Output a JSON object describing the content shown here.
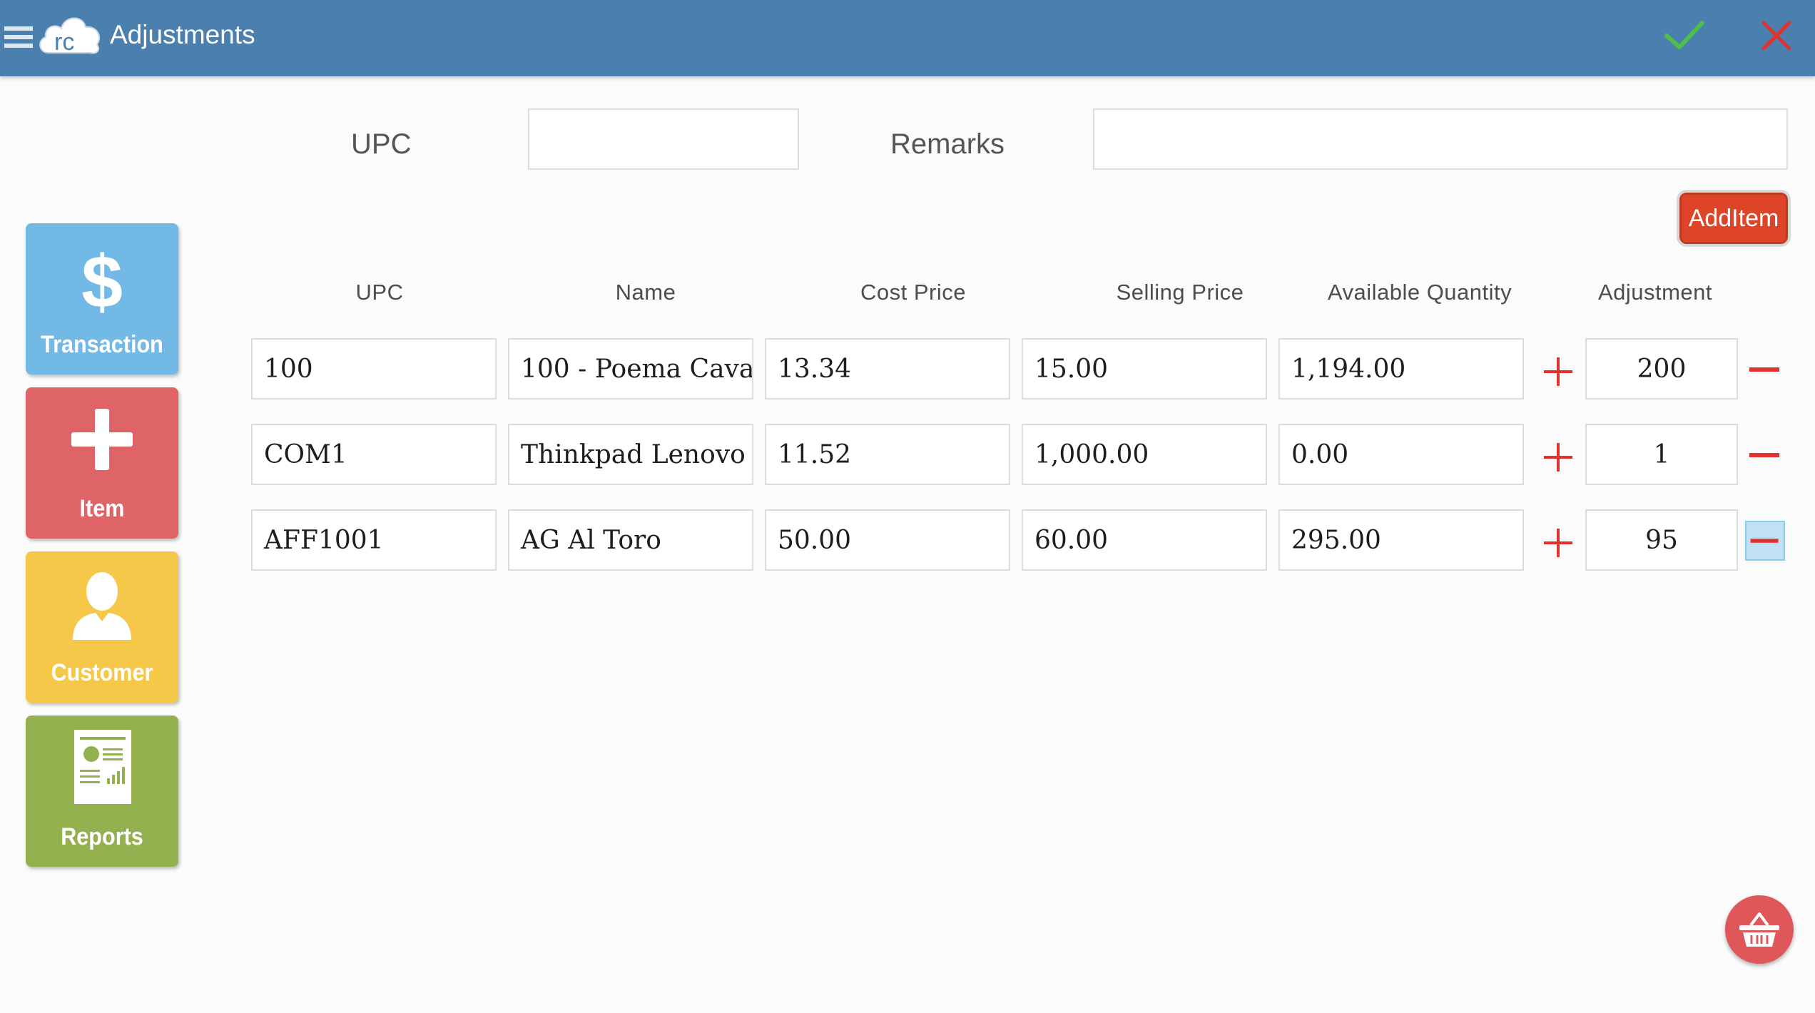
{
  "header": {
    "title": "Adjustments",
    "logo_text": "rc",
    "icons": {
      "menu": "menu-icon",
      "confirm": "check-icon",
      "close": "close-icon"
    },
    "colors": {
      "bar": "#4a7fae",
      "confirm": "#4cc04a",
      "close": "#e0322e"
    }
  },
  "form": {
    "upc_label": "UPC",
    "upc_value": "",
    "remarks_label": "Remarks",
    "remarks_value": "",
    "add_item_label": "AddItem"
  },
  "sidebar": {
    "items": [
      {
        "label": "Transaction",
        "icon": "dollar-icon",
        "color": "#73b9e6"
      },
      {
        "label": "Item",
        "icon": "plus-icon",
        "color": "#df6468"
      },
      {
        "label": "Customer",
        "icon": "person-icon",
        "color": "#f6c84a"
      },
      {
        "label": "Reports",
        "icon": "report-icon",
        "color": "#94b150"
      }
    ]
  },
  "table": {
    "headers": [
      "UPC",
      "Name",
      "Cost Price",
      "Selling Price",
      "Available Quantity",
      "Adjustment"
    ],
    "rows": [
      {
        "upc": "100",
        "name": "100 - Poema Cava",
        "cost_price": "13.34",
        "selling_price": "15.00",
        "available_qty": "1,194.00",
        "adjustment": "200"
      },
      {
        "upc": "COM1",
        "name": "Thinkpad Lenovo",
        "cost_price": "11.52",
        "selling_price": "1,000.00",
        "available_qty": "0.00",
        "adjustment": "1"
      },
      {
        "upc": "AFF1001",
        "name": "AG Al Toro",
        "cost_price": "50.00",
        "selling_price": "60.00",
        "available_qty": "295.00",
        "adjustment": "95"
      }
    ]
  },
  "fab": {
    "icon": "basket-icon",
    "color": "#e0575a"
  }
}
